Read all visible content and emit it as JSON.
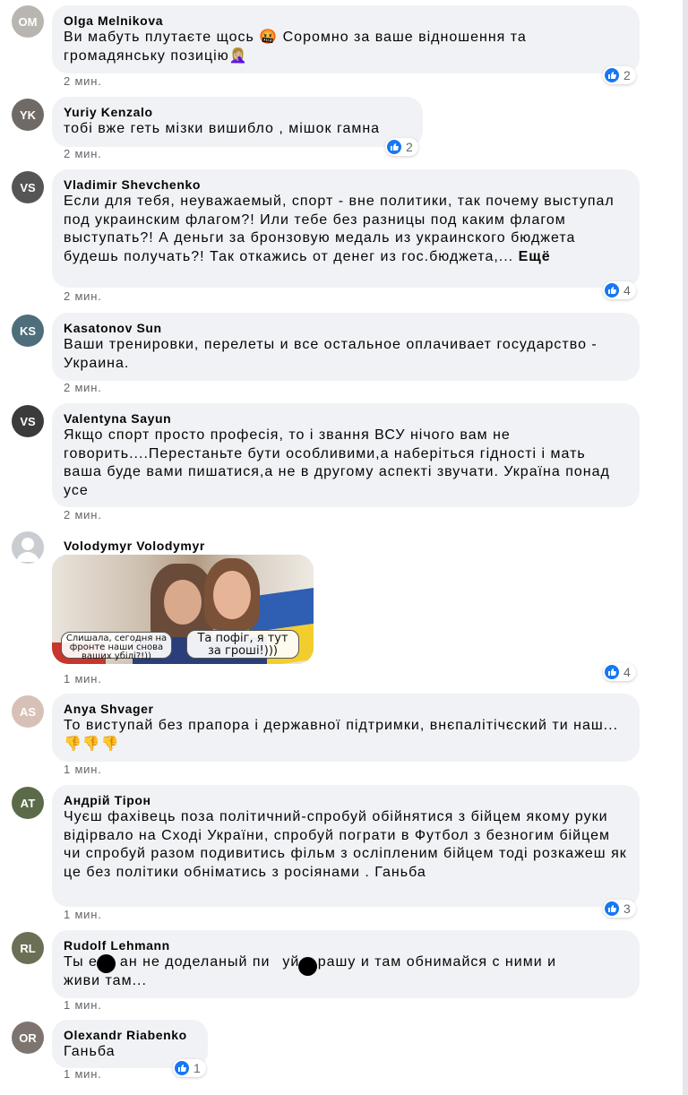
{
  "colors": {
    "like_blue": "#1877f2",
    "bubble_bg": "#f0f2f5",
    "meta_gray": "#65676b"
  },
  "comments": [
    {
      "author": "Olga Melnikova",
      "text": "Ви мабуть плутаєте щось 🤬 Соромно за ваше відношення та громадянську позицію🤦🏼‍♀️",
      "time": "2 мин.",
      "likes": "2",
      "reaction_icon": "like-icon"
    },
    {
      "author": "Yuriy Kenzalo",
      "text": "тобі вже геть мізки вишибло , мішок гамна",
      "time": "2 мин.",
      "likes": "2",
      "reaction_icon": "like-icon"
    },
    {
      "author": "Vladimir Shevchenko",
      "text": "Если для тебя, неуважаемый, спорт - вне политики, так почему выступал под украинским флагом?! Или тебе без разницы под каким флагом выступать?! А деньги за бронзовую медаль из украинского бюджета будешь получать?! Так откажись от денег из гос.бюджета,...",
      "more": "Ещё",
      "time": "2 мин.",
      "likes": "4",
      "reaction_icon": "like-icon"
    },
    {
      "author": "Kasatonov Sun",
      "text": "Ваши тренировки, перелеты и все остальное оплачивает государство - Украина.",
      "time": "2 мин."
    },
    {
      "author": "Valentyna Sayun",
      "text": "Якщо спорт просто професія, то і звання ВСУ нічого вам не говорить....Перестаньте бути особливими,а наберіться гідності і мать ваша буде вами пишатися,а не в другому аспекті звучати. Україна понад усе",
      "time": "2 мин."
    },
    {
      "author": "Volodymyr Volodymyr",
      "meme_caption_left": "Слишала, сегодня на фронте наши снова ваших убілі?!))",
      "meme_caption_right": "Та пофіг, я тут за гроші!)))",
      "time": "1 мин.",
      "likes": "4",
      "reaction_icon": "like-icon"
    },
    {
      "author": "Anya Shvager",
      "text": "То виступай без прапора і державної підтримки, внєпалітічєский ти наш... 👎👎👎",
      "time": "1 мин."
    },
    {
      "author": "Андрій Тірон",
      "text": "Чуєш фахівець поза політичний-спробуй обійнятися з бійцем якому руки відірвало на Сході України, спробуй пограти в Футбол з безногим бійцем чи спробуй разом подивитись фільм з осліпленим бійцем тоді розкажеш як це без політики обніматись з росіянами . Ганьба",
      "time": "1 мин.",
      "likes": "3",
      "reaction_icon": "like-icon"
    },
    {
      "author": "Rudolf Lehmann",
      "text_line1_a": "Ты е",
      "text_line1_b": "ан не доделаный пи",
      "text_line1_c": "уй в рашу и там обнимайся с ними и",
      "text_line2": "живи там...",
      "time": "1 мин."
    },
    {
      "author": "Olexandr Riabenko",
      "text": "Ганьба",
      "time": "1 мин.",
      "likes": "1",
      "reaction_icon": "like-icon"
    }
  ]
}
